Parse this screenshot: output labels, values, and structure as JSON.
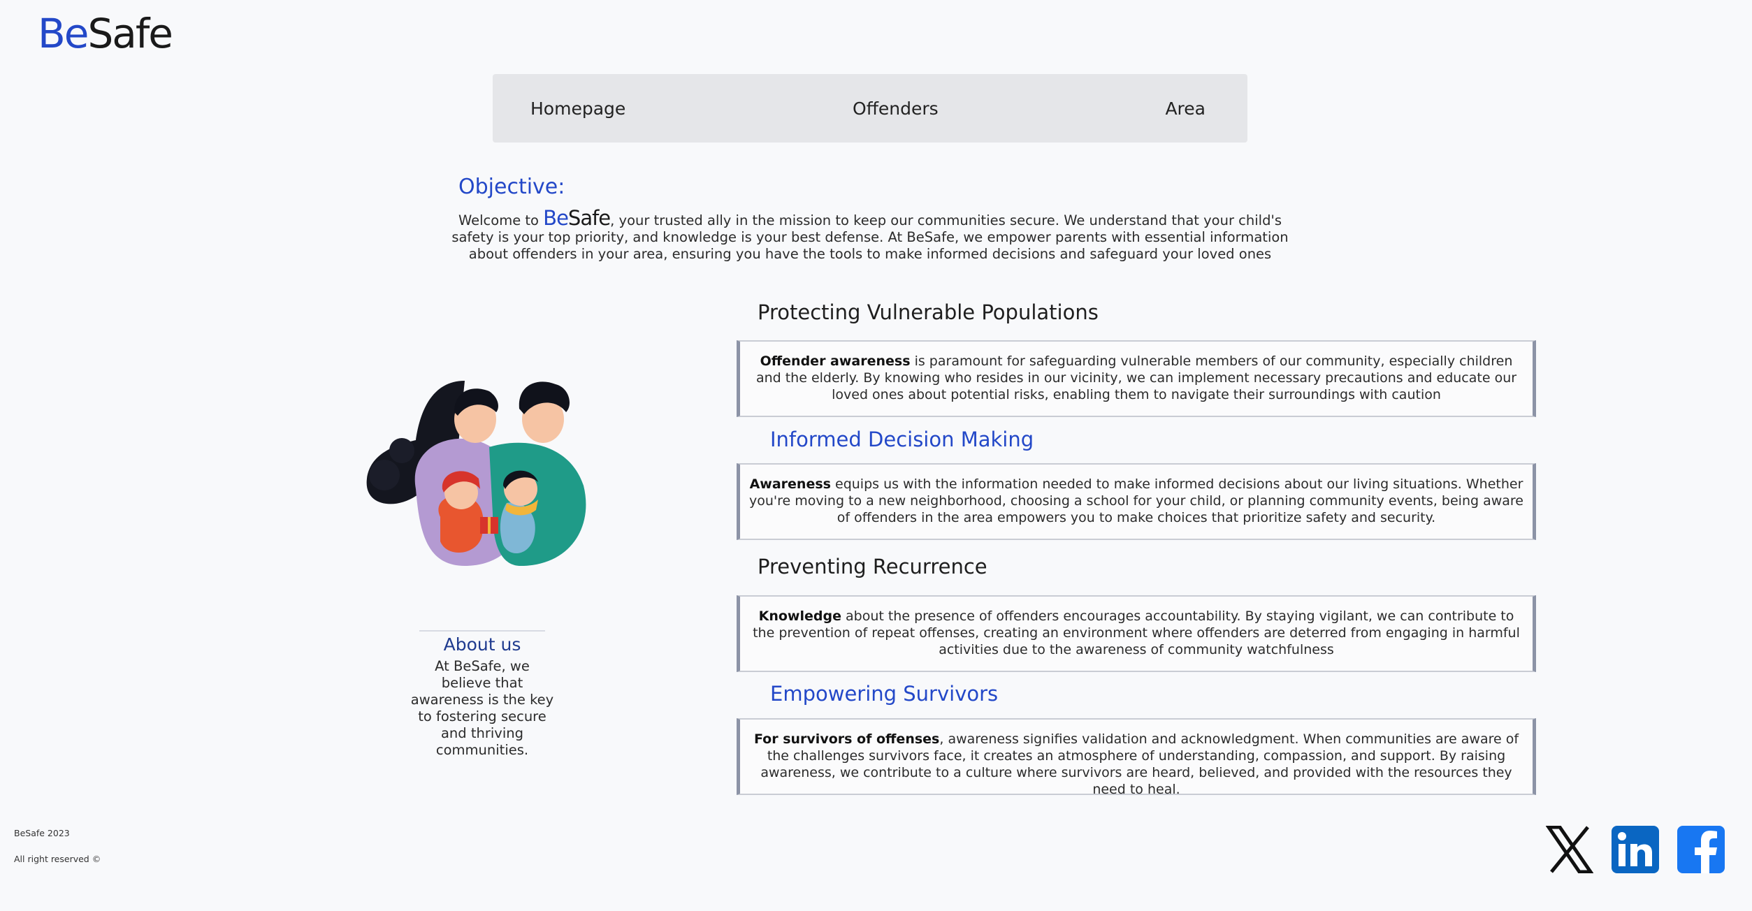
{
  "brand": {
    "be": "Be",
    "safe": "Safe"
  },
  "nav": {
    "items": [
      "Homepage",
      "Offenders",
      "Area"
    ]
  },
  "objective": {
    "title": "Objective:",
    "text_before": "Welcome to ",
    "text_after": ", your trusted ally in the mission to keep our communities secure. We understand that your child's safety is your top priority, and knowledge is your best defense. At BeSafe, we empower parents with essential information about offenders in your area, ensuring you have the tools to make informed decisions and safeguard your loved ones"
  },
  "about": {
    "title": "About us",
    "text": "At BeSafe, we believe that awareness is the key to fostering secure and thriving communities."
  },
  "sections": [
    {
      "title": "Protecting Vulnerable Populations",
      "bold": "Offender awareness",
      "text": " is paramount for safeguarding vulnerable members of our community, especially children and the elderly. By knowing who resides in our vicinity, we can implement necessary precautions and educate our loved ones about potential risks, enabling them to navigate their surroundings with caution"
    },
    {
      "title": "Informed Decision Making",
      "bold": "Awareness",
      "text": " equips us with the information needed to make informed decisions about our living situations. Whether you're moving to a new neighborhood, choosing a school for your child, or planning community events, being aware of offenders in the area empowers you to make choices that prioritize safety and security."
    },
    {
      "title": "Preventing Recurrence",
      "bold": "Knowledge",
      "text": " about the presence of offenders encourages accountability. By staying vigilant, we can contribute to the prevention of repeat offenses, creating an environment where offenders are deterred from engaging in harmful activities due to the awareness of community watchfulness"
    },
    {
      "title": "Empowering Survivors",
      "bold": "For survivors of offenses",
      "text": ", awareness signifies validation and acknowledgment. When communities are aware of the challenges survivors face, it creates an atmosphere of understanding, compassion, and support. By raising awareness, we contribute to a culture where survivors are heard, believed, and provided with the resources they need to heal."
    }
  ],
  "footer": {
    "line1": "BeSafe 2023",
    "line2": "All right reserved ©"
  },
  "social": {
    "icons": [
      "x-icon",
      "linkedin-icon",
      "facebook-icon"
    ]
  },
  "colors": {
    "accent": "#2348c8",
    "linkedin": "#0a66c2",
    "facebook": "#1877f2"
  }
}
